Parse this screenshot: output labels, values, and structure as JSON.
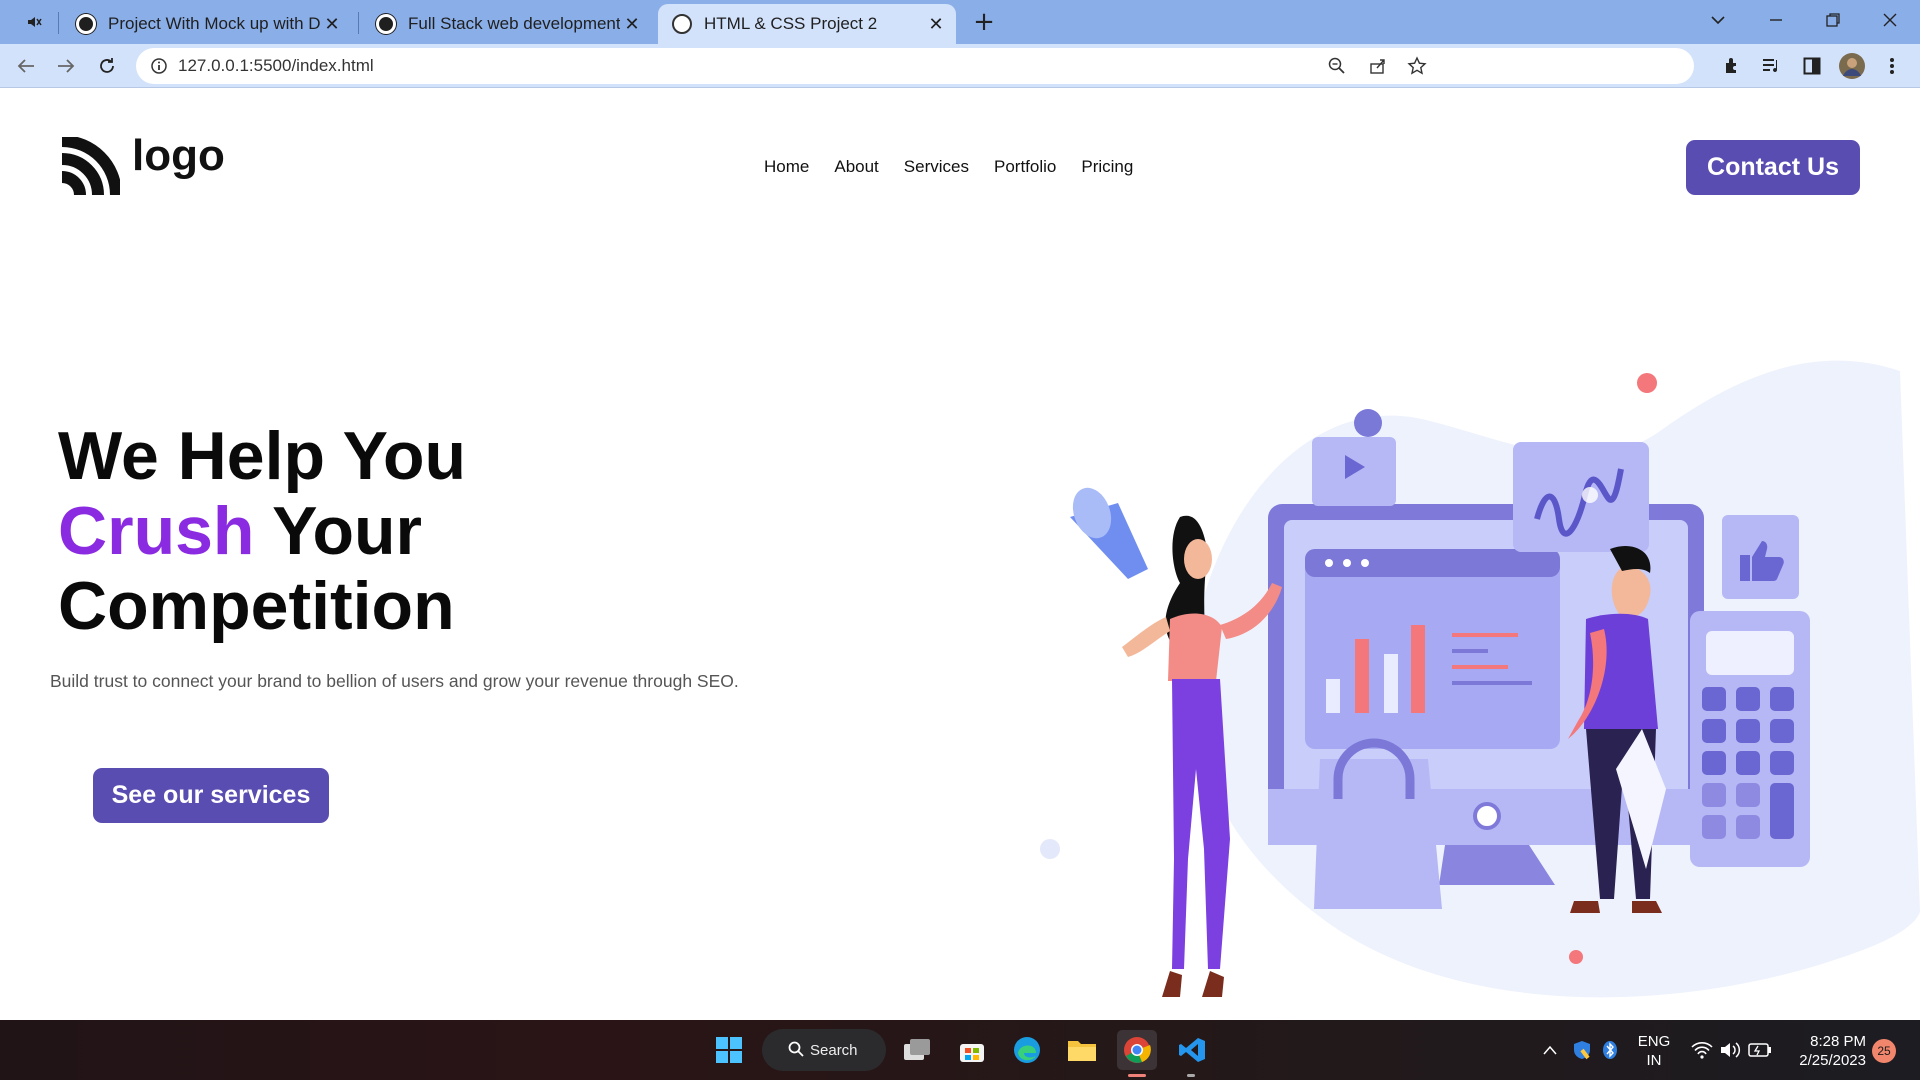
{
  "browser": {
    "tabs": [
      {
        "title": "Project With Mock up with Desig",
        "favicon": "wordpress-icon"
      },
      {
        "title": "Full Stack web development - Co",
        "favicon": "wordpress-icon"
      },
      {
        "title": "HTML & CSS Project 2",
        "favicon": "globe-icon",
        "active": true
      }
    ],
    "url": "127.0.0.1:5500/index.html"
  },
  "site": {
    "logo_text": "logo",
    "nav": [
      "Home",
      "About",
      "Services",
      "Portfolio",
      "Pricing"
    ],
    "contact_label": "Contact Us",
    "hero": {
      "line1": "We Help You",
      "line2_accent": "Crush",
      "line2_rest": " Your",
      "line3": "Competition",
      "subtitle": "Build trust to connect your brand to bellion of users and grow your revenue through SEO.",
      "cta_label": "See our services"
    },
    "colors": {
      "primary": "#5a4db2",
      "accent": "#8a2be2",
      "blob": "#eef2fd"
    }
  },
  "taskbar": {
    "search_label": "Search",
    "lang_line1": "ENG",
    "lang_line2": "IN",
    "time": "8:28 PM",
    "date": "2/25/2023",
    "notification_count": "25"
  }
}
